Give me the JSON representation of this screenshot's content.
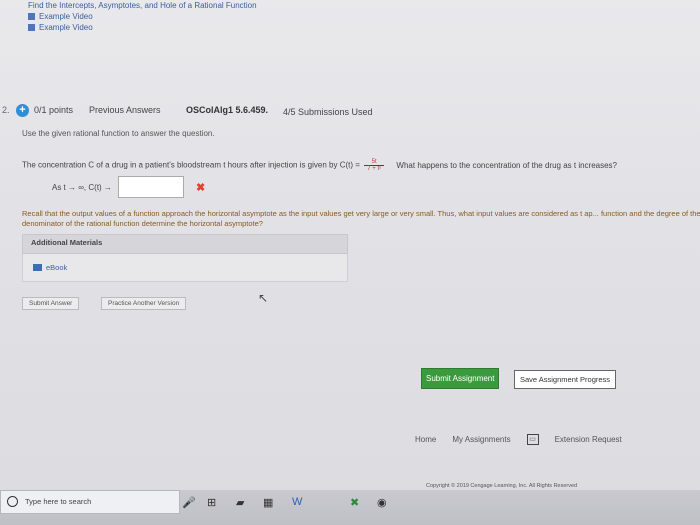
{
  "top_links": {
    "cut_item": "Find the Intercepts, Asymptotes, and Hole of a Rational Function",
    "item1": "Example Video",
    "item2": "Example Video"
  },
  "question": {
    "number": "2.",
    "points": "0/1 points",
    "previous_answers": "Previous Answers",
    "id": "OSColAlg1 5.6.459.",
    "submissions": "4/5 Submissions Used",
    "instruction": "Use the given rational function to answer the question.",
    "problem_text": "The concentration C of a drug in a patient's bloodstream t hours after injection is given by",
    "function_lhs": "C(t) =",
    "fraction_num": "5t",
    "fraction_den": "7 + t²",
    "problem_tail": "What happens to the concentration of the drug as t increases?",
    "answer_prefix": "As t → ∞, C(t) →",
    "answer_value": "",
    "wrong_mark": "✖",
    "hint": "Recall that the output values of a function approach the horizontal asymptote as the input values get very large or very small. Thus, what input values are considered as t ap... function and the degree of the denominator of the rational function determine the horizontal asymptote?",
    "additional_materials": "Additional Materials",
    "ebook": "eBook",
    "submit_answer": "Submit Answer",
    "practice_version": "Practice Another Version"
  },
  "assignment": {
    "submit": "Submit Assignment",
    "save": "Save Assignment Progress"
  },
  "footer": {
    "home": "Home",
    "my_assignments": "My Assignments",
    "extension": "Extension Request",
    "copyright": "Copyright © 2019 Cengage Learning, Inc. All Rights Reserved"
  },
  "taskbar": {
    "search_placeholder": "Type here to search"
  }
}
